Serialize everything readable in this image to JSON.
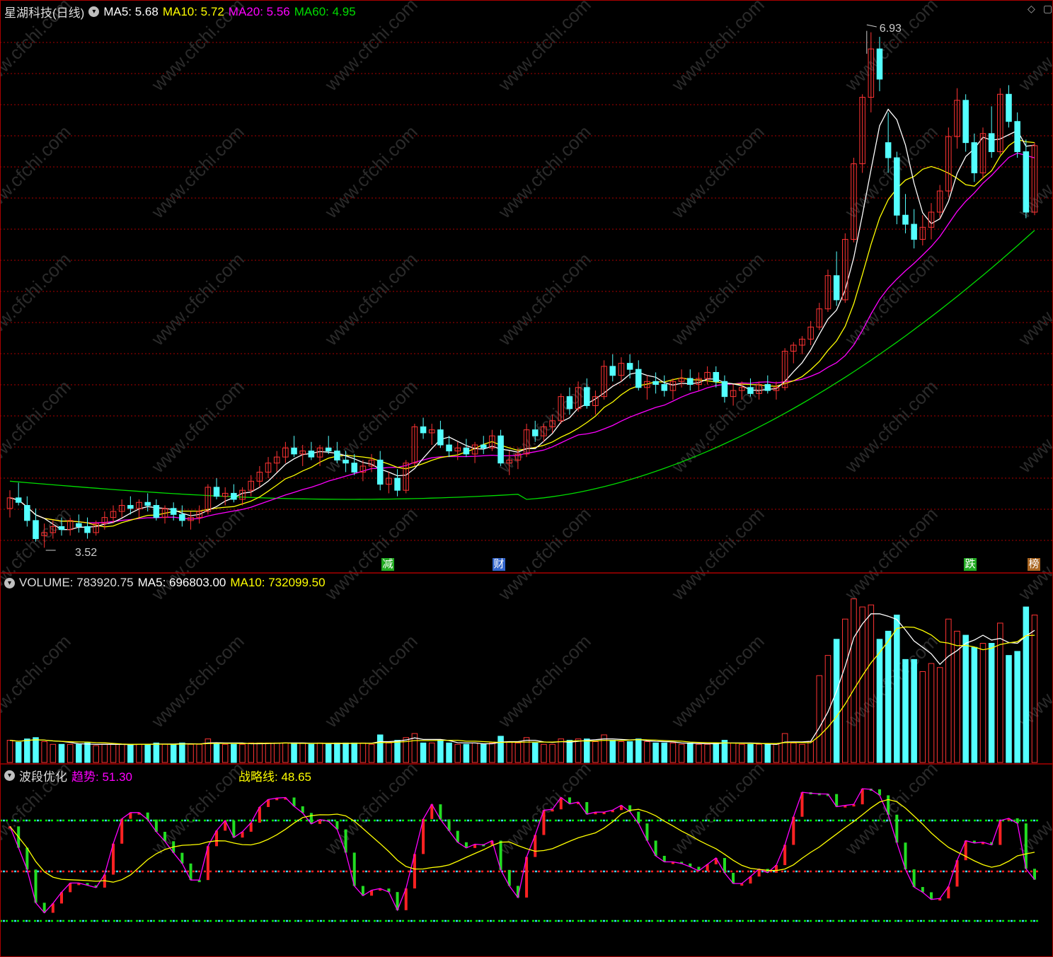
{
  "price_header": {
    "name": "星湖科技(日线)",
    "ma5": "MA5: 5.68",
    "ma10": "MA10: 5.72",
    "ma20": "MA20: 5.56",
    "ma60": "MA60: 4.95"
  },
  "volume_header": {
    "volume": "VOLUME: 783920.75",
    "ma5": "MA5: 696803.00",
    "ma10": "MA10: 732099.50"
  },
  "indicator_header": {
    "name": "波段优化",
    "trend": "趋势: 51.30",
    "strategy": "战略线: 48.65"
  },
  "annotations": {
    "high": "6.93",
    "low": "3.52"
  },
  "markers": [
    {
      "label": "减",
      "color": "#22aa22"
    },
    {
      "label": "财",
      "color": "#3366cc"
    },
    {
      "label": "跌",
      "color": "#22aa22"
    },
    {
      "label": "榜",
      "color": "#aa6622"
    }
  ],
  "watermark": "www.cfchi.com",
  "colors": {
    "up": "#ff3333",
    "down": "#54ffff",
    "ma5": "#ffffff",
    "ma10": "#ffff00",
    "ma20": "#ff00ff",
    "ma60": "#00dd00",
    "grid": "#aa0000"
  },
  "chart_data": {
    "type": "candlestick",
    "ohlc": [
      [
        3.78,
        3.9,
        3.72,
        3.85
      ],
      [
        3.85,
        3.95,
        3.8,
        3.82
      ],
      [
        3.8,
        3.86,
        3.66,
        3.7
      ],
      [
        3.7,
        3.78,
        3.56,
        3.58
      ],
      [
        3.6,
        3.68,
        3.52,
        3.62
      ],
      [
        3.62,
        3.7,
        3.58,
        3.66
      ],
      [
        3.66,
        3.72,
        3.6,
        3.64
      ],
      [
        3.64,
        3.72,
        3.6,
        3.7
      ],
      [
        3.68,
        3.74,
        3.62,
        3.66
      ],
      [
        3.66,
        3.72,
        3.58,
        3.62
      ],
      [
        3.62,
        3.7,
        3.6,
        3.68
      ],
      [
        3.68,
        3.76,
        3.64,
        3.72
      ],
      [
        3.72,
        3.8,
        3.68,
        3.76
      ],
      [
        3.76,
        3.84,
        3.72,
        3.8
      ],
      [
        3.8,
        3.86,
        3.74,
        3.78
      ],
      [
        3.78,
        3.84,
        3.72,
        3.82
      ],
      [
        3.82,
        3.88,
        3.76,
        3.8
      ],
      [
        3.8,
        3.84,
        3.7,
        3.72
      ],
      [
        3.72,
        3.8,
        3.68,
        3.78
      ],
      [
        3.78,
        3.82,
        3.7,
        3.74
      ],
      [
        3.74,
        3.8,
        3.66,
        3.7
      ],
      [
        3.7,
        3.76,
        3.64,
        3.72
      ],
      [
        3.72,
        3.8,
        3.68,
        3.76
      ],
      [
        3.76,
        3.94,
        3.74,
        3.92
      ],
      [
        3.92,
        3.98,
        3.84,
        3.86
      ],
      [
        3.86,
        3.92,
        3.8,
        3.88
      ],
      [
        3.88,
        3.94,
        3.82,
        3.84
      ],
      [
        3.84,
        3.92,
        3.8,
        3.9
      ],
      [
        3.9,
        4.0,
        3.86,
        3.96
      ],
      [
        3.96,
        4.06,
        3.92,
        4.02
      ],
      [
        4.02,
        4.12,
        3.98,
        4.08
      ],
      [
        4.08,
        4.16,
        4.02,
        4.12
      ],
      [
        4.12,
        4.22,
        4.08,
        4.18
      ],
      [
        4.18,
        4.26,
        4.12,
        4.14
      ],
      [
        4.14,
        4.2,
        4.06,
        4.16
      ],
      [
        4.16,
        4.22,
        4.1,
        4.12
      ],
      [
        4.12,
        4.2,
        4.06,
        4.18
      ],
      [
        4.18,
        4.26,
        4.14,
        4.16
      ],
      [
        4.16,
        4.22,
        4.08,
        4.1
      ],
      [
        4.1,
        4.16,
        4.02,
        4.08
      ],
      [
        4.08,
        4.14,
        4.0,
        4.02
      ],
      [
        4.02,
        4.1,
        3.96,
        4.06
      ],
      [
        4.06,
        4.14,
        4.02,
        4.1
      ],
      [
        4.1,
        4.16,
        3.9,
        3.94
      ],
      [
        3.94,
        4.02,
        3.88,
        3.98
      ],
      [
        3.98,
        4.04,
        3.86,
        3.9
      ],
      [
        3.9,
        4.1,
        3.88,
        4.08
      ],
      [
        4.08,
        4.34,
        4.06,
        4.32
      ],
      [
        4.32,
        4.38,
        4.24,
        4.28
      ],
      [
        4.28,
        4.34,
        4.2,
        4.3
      ],
      [
        4.3,
        4.36,
        4.18,
        4.2
      ],
      [
        4.2,
        4.26,
        4.12,
        4.16
      ],
      [
        4.16,
        4.22,
        4.1,
        4.18
      ],
      [
        4.18,
        4.24,
        4.12,
        4.14
      ],
      [
        4.14,
        4.22,
        4.08,
        4.2
      ],
      [
        4.2,
        4.26,
        4.14,
        4.18
      ],
      [
        4.18,
        4.3,
        4.16,
        4.26
      ],
      [
        4.26,
        4.3,
        4.06,
        4.08
      ],
      [
        4.08,
        4.16,
        4.0,
        4.1
      ],
      [
        4.1,
        4.18,
        4.04,
        4.14
      ],
      [
        4.14,
        4.34,
        4.12,
        4.3
      ],
      [
        4.3,
        4.36,
        4.22,
        4.26
      ],
      [
        4.26,
        4.34,
        4.22,
        4.32
      ],
      [
        4.32,
        4.4,
        4.28,
        4.36
      ],
      [
        4.36,
        4.54,
        4.34,
        4.52
      ],
      [
        4.52,
        4.58,
        4.4,
        4.44
      ],
      [
        4.44,
        4.62,
        4.42,
        4.58
      ],
      [
        4.58,
        4.64,
        4.44,
        4.46
      ],
      [
        4.46,
        4.56,
        4.4,
        4.52
      ],
      [
        4.52,
        4.76,
        4.5,
        4.72
      ],
      [
        4.72,
        4.8,
        4.62,
        4.66
      ],
      [
        4.66,
        4.78,
        4.62,
        4.74
      ],
      [
        4.74,
        4.8,
        4.64,
        4.7
      ],
      [
        4.7,
        4.76,
        4.56,
        4.58
      ],
      [
        4.58,
        4.66,
        4.5,
        4.62
      ],
      [
        4.62,
        4.68,
        4.54,
        4.6
      ],
      [
        4.6,
        4.66,
        4.52,
        4.56
      ],
      [
        4.56,
        4.64,
        4.5,
        4.62
      ],
      [
        4.62,
        4.7,
        4.58,
        4.64
      ],
      [
        4.64,
        4.7,
        4.56,
        4.6
      ],
      [
        4.6,
        4.68,
        4.56,
        4.64
      ],
      [
        4.64,
        4.72,
        4.6,
        4.68
      ],
      [
        4.68,
        4.72,
        4.58,
        4.62
      ],
      [
        4.62,
        4.66,
        4.48,
        4.52
      ],
      [
        4.52,
        4.6,
        4.46,
        4.56
      ],
      [
        4.56,
        4.62,
        4.5,
        4.58
      ],
      [
        4.58,
        4.64,
        4.52,
        4.54
      ],
      [
        4.54,
        4.62,
        4.5,
        4.6
      ],
      [
        4.6,
        4.66,
        4.54,
        4.56
      ],
      [
        4.56,
        4.62,
        4.5,
        4.58
      ],
      [
        4.58,
        4.84,
        4.56,
        4.82
      ],
      [
        4.82,
        4.88,
        4.74,
        4.86
      ],
      [
        4.86,
        4.92,
        4.8,
        4.9
      ],
      [
        4.9,
        5.02,
        4.86,
        4.98
      ],
      [
        4.98,
        5.14,
        4.96,
        5.1
      ],
      [
        5.1,
        5.36,
        5.08,
        5.32
      ],
      [
        5.32,
        5.48,
        5.12,
        5.16
      ],
      [
        5.16,
        5.6,
        5.14,
        5.56
      ],
      [
        5.56,
        6.1,
        5.54,
        6.06
      ],
      [
        6.06,
        6.52,
        6.0,
        6.5
      ],
      [
        6.5,
        6.93,
        6.4,
        6.82
      ],
      [
        6.82,
        6.9,
        6.54,
        6.62
      ],
      [
        6.2,
        6.4,
        6.0,
        6.1
      ],
      [
        6.1,
        6.14,
        5.66,
        5.72
      ],
      [
        5.72,
        5.86,
        5.6,
        5.66
      ],
      [
        5.66,
        5.76,
        5.5,
        5.56
      ],
      [
        5.56,
        5.72,
        5.52,
        5.64
      ],
      [
        5.64,
        5.8,
        5.56,
        5.74
      ],
      [
        5.74,
        5.92,
        5.7,
        5.88
      ],
      [
        5.88,
        6.3,
        5.84,
        6.24
      ],
      [
        6.24,
        6.56,
        6.16,
        6.48
      ],
      [
        6.48,
        6.52,
        6.14,
        6.2
      ],
      [
        6.2,
        6.26,
        5.94,
        6.0
      ],
      [
        6.0,
        6.3,
        5.96,
        6.26
      ],
      [
        6.26,
        6.44,
        6.1,
        6.14
      ],
      [
        6.14,
        6.56,
        6.12,
        6.52
      ],
      [
        6.52,
        6.58,
        6.3,
        6.34
      ],
      [
        6.34,
        6.4,
        6.1,
        6.14
      ],
      [
        6.14,
        6.22,
        5.7,
        5.74
      ],
      [
        5.74,
        6.2,
        5.72,
        6.18
      ]
    ],
    "ma60_range": [
      3.84,
      5.42
    ]
  }
}
